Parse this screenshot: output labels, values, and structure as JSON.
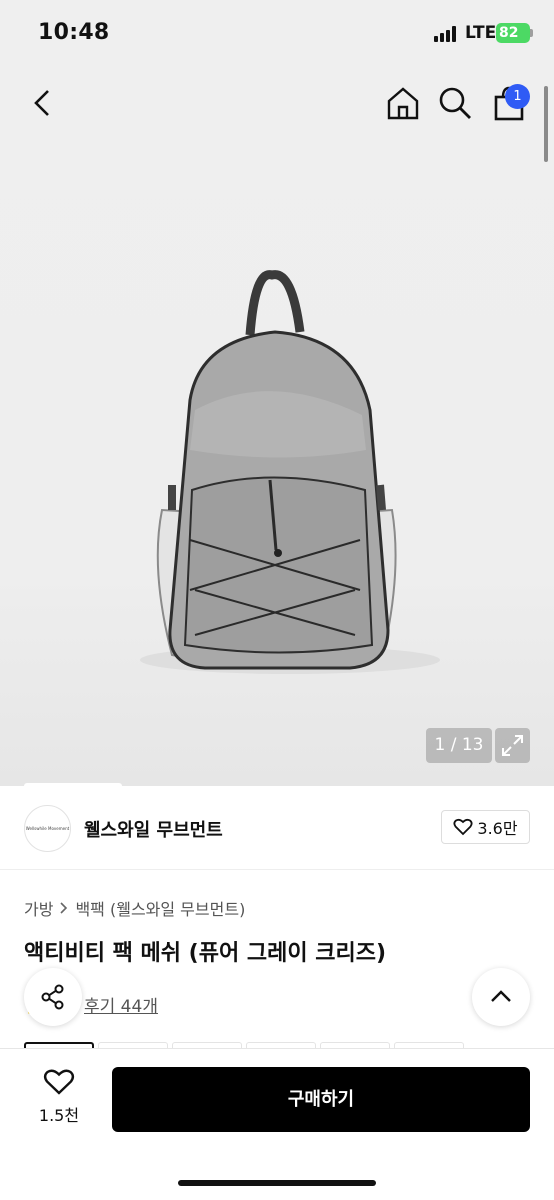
{
  "status_bar": {
    "time": "10:48",
    "network": "LTE",
    "battery": "82"
  },
  "header": {
    "cart_badge": "1"
  },
  "hero": {
    "counter": "1 / 13"
  },
  "brand": {
    "name": "웰스와일 무브먼트",
    "logo_text": "Wellswhile Movement",
    "likes": "3.6만"
  },
  "breadcrumb": [
    "가방",
    "백팩 (웰스와일 무브먼트)"
  ],
  "product": {
    "title": "액티비티 팩 메쉬 (퓨어 그레이 크리즈)",
    "reviews": "후기 44개"
  },
  "bottom": {
    "wish_count": "1.5천",
    "buy_label": "구매하기"
  },
  "colors": {
    "accent": "#2f5bf5",
    "buy_button": "#000000",
    "battery": "#4cd964"
  }
}
